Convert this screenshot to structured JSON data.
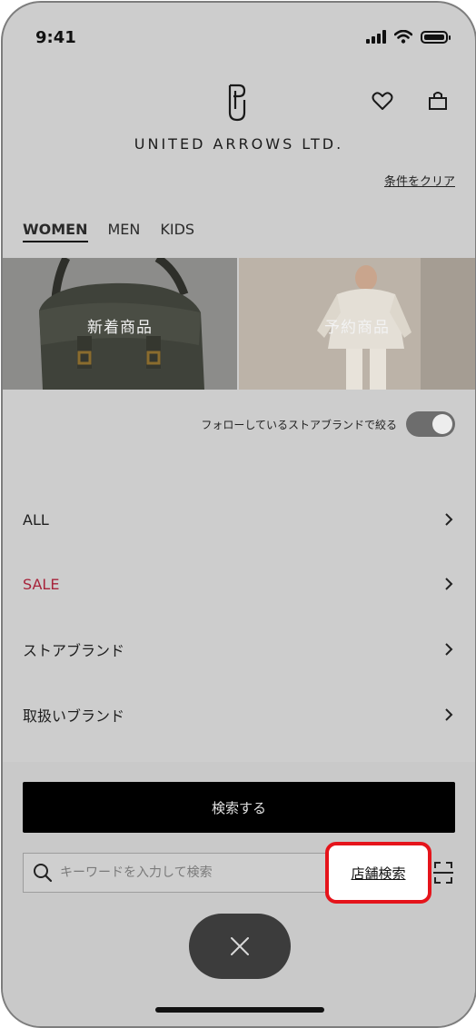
{
  "status_bar": {
    "time": "9:41"
  },
  "header": {
    "brand": "UNITED ARROWS LTD.",
    "clear_link": "条件をクリア"
  },
  "tabs": [
    {
      "label": "WOMEN",
      "active": true
    },
    {
      "label": "MEN",
      "active": false
    },
    {
      "label": "KIDS",
      "active": false
    }
  ],
  "banners": [
    {
      "label": "新着商品"
    },
    {
      "label": "予約商品"
    }
  ],
  "follow_filter": {
    "label": "フォローしているストアブランドで絞る",
    "enabled": true
  },
  "menu": [
    {
      "label": "ALL"
    },
    {
      "label": "SALE"
    },
    {
      "label": "ストアブランド"
    },
    {
      "label": "取扱いブランド"
    }
  ],
  "actions": {
    "search_button": "検索する",
    "keyword_placeholder": "キーワードを入力して検索",
    "store_search": "店舗検索"
  },
  "colors": {
    "sale": "#a7233a",
    "highlight": "#e5141b"
  }
}
